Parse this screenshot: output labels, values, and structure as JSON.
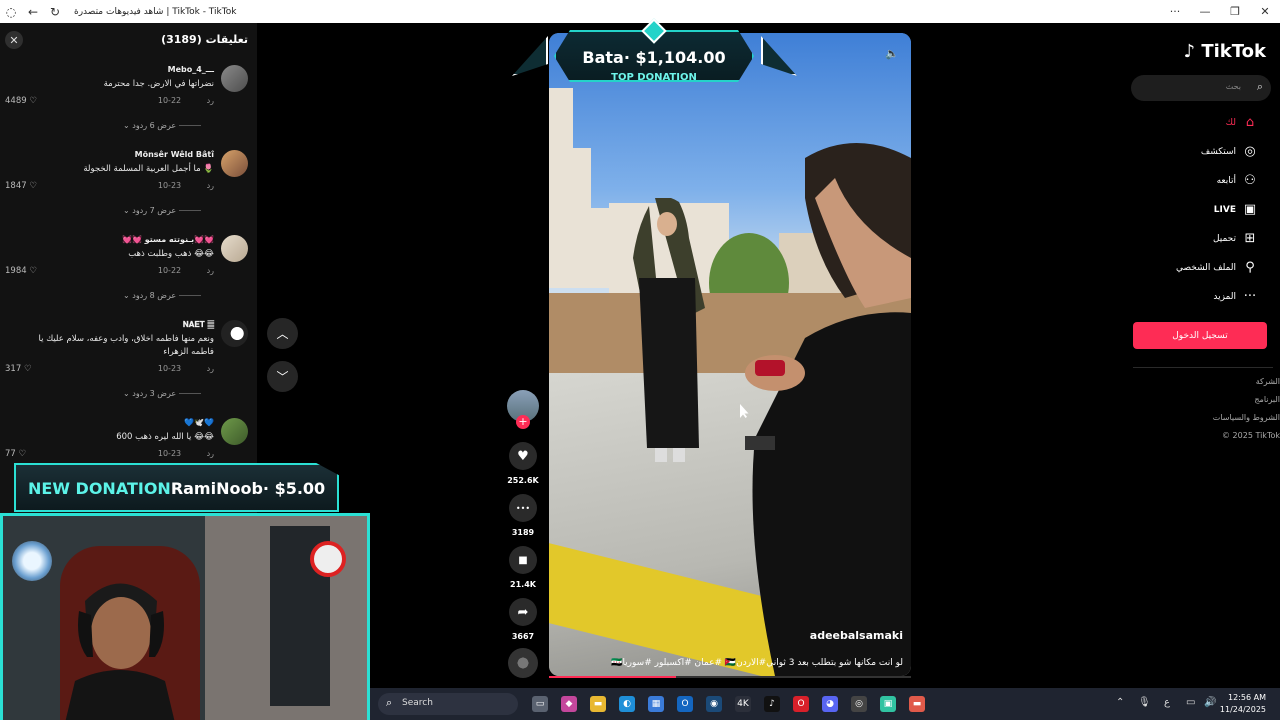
{
  "browser": {
    "tab_title": "شاهد فيديوهات متصدرة | TikTok - TikTok",
    "back_icon": "←",
    "reload_icon": "↻",
    "app_icon": "◌"
  },
  "comments": {
    "title": "تعليقات (3189)",
    "close_icon": "✕",
    "items": [
      {
        "user": "Mebo_4_ـــ",
        "text": "نضراتها في الارض. جدا محترمة",
        "date": "10-22",
        "reply": "رد",
        "likes": "4489",
        "replies": "عرض 6 ردود"
      },
      {
        "user": "Mõnsêr Wêld Bâtî",
        "text": "ما أجمل العربية المسلمة الخجولة 🌷",
        "date": "10-23",
        "reply": "رد",
        "likes": "1847",
        "replies": "عرض 7 ردود"
      },
      {
        "user": "💓💓 بـنوتته مستو💓💓",
        "text": "ذهب وطلبت ذهب 😂😂",
        "date": "10-22",
        "reply": "رد",
        "likes": "1984",
        "replies": "عرض 8 ردود"
      },
      {
        "user": "𝐍𝐀𝐄𝐓 𝄛",
        "text": "ونعم منها فاطمه اخلاق، وادب وعفه، سلام عليك يا فاطمه الزهراء",
        "date": "10-23",
        "reply": "رد",
        "likes": "317",
        "replies": "عرض 3 ردود"
      },
      {
        "user": "💙🕊️💙",
        "text": "يا الله ليره ذهب 600 😂😂",
        "date": "10-23",
        "reply": "رد",
        "likes": "77"
      }
    ]
  },
  "nav_arrows": {
    "up": "︿",
    "down": "﹀"
  },
  "donation_top": {
    "amount": "Bata· $1,104.00",
    "label": "TOP DONATION"
  },
  "donation_new": {
    "label": "NEW DONATION",
    "donor": "RamiNoob· $5.00"
  },
  "video": {
    "handle": "adeebalsamaki",
    "caption": "لو انت مكانها شو بتطلب بعد 3 ثواني#الاردن🇯🇴 #عمان #اكسبلور #سوريا🇸🇾",
    "speaker_icon": "🔈",
    "progress": 0.35
  },
  "actions": {
    "like_icon": "♥",
    "likes": "252.6K",
    "comment_icon": "•••",
    "comments": "3189",
    "save_icon": "■",
    "saves": "21.4K",
    "share_icon": "➦",
    "shares": "3667",
    "follow_icon": "+"
  },
  "sidebar": {
    "logo": "♪ TikTok",
    "search_placeholder": "بحث",
    "search_icon": "⌕",
    "nav": [
      {
        "label": "لك",
        "icon": "⌂",
        "active": true
      },
      {
        "label": "استكشف",
        "icon": "◎"
      },
      {
        "label": "أتابعه",
        "icon": "⚇"
      },
      {
        "label": "LIVE",
        "icon": "▣"
      },
      {
        "label": "تحميل",
        "icon": "⊞"
      },
      {
        "label": "الملف الشخصي",
        "icon": "⚲"
      },
      {
        "label": "المزيد",
        "icon": "···"
      }
    ],
    "login": "تسجيل الدخول",
    "footer": [
      "الشركة",
      "البرنامج",
      "الشروط والسياسات",
      "© 2025 TikTok"
    ]
  },
  "taskbar": {
    "search_label": "Search",
    "search_icon": "⌕",
    "time": "12:56 AM",
    "date": "11/24/2025",
    "lang": "ع",
    "apps": [
      {
        "name": "task-view-app",
        "glyph": "▭",
        "color": "#5a6270"
      },
      {
        "name": "m365-app",
        "glyph": "◆",
        "color": "#c4479c"
      },
      {
        "name": "file-explorer-app",
        "glyph": "▬",
        "color": "#e8b832"
      },
      {
        "name": "edge-app",
        "glyph": "◐",
        "color": "#1f8fd8"
      },
      {
        "name": "store-app",
        "glyph": "▦",
        "color": "#3b7bd8"
      },
      {
        "name": "outlook-app",
        "glyph": "O",
        "color": "#1466c0"
      },
      {
        "name": "steam-app",
        "glyph": "◉",
        "color": "#1b4a78"
      },
      {
        "name": "4k-app",
        "glyph": "4K",
        "color": "#2b2f3a"
      },
      {
        "name": "tiktok-app",
        "glyph": "♪",
        "color": "#111"
      },
      {
        "name": "opera-app",
        "glyph": "O",
        "color": "#d8202a"
      },
      {
        "name": "discord-app",
        "glyph": "◕",
        "color": "#5865f2"
      },
      {
        "name": "obs-app",
        "glyph": "◎",
        "color": "#444"
      },
      {
        "name": "streamlabs-app",
        "glyph": "▣",
        "color": "#31c3a2"
      },
      {
        "name": "media-app",
        "glyph": "▬",
        "color": "#e05a4a"
      }
    ]
  }
}
